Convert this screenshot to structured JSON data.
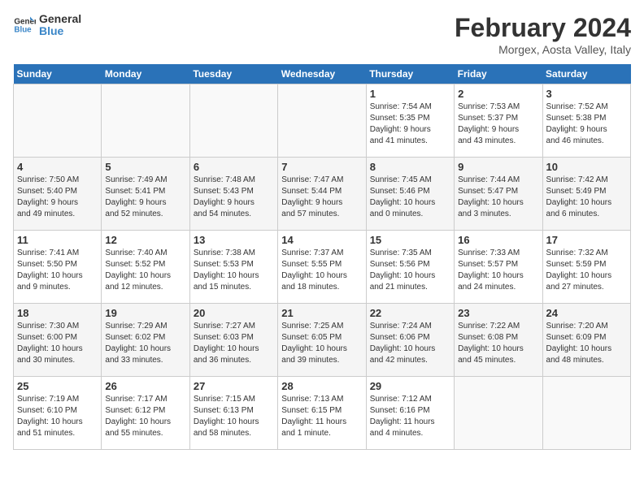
{
  "logo": {
    "line1": "General",
    "line2": "Blue"
  },
  "title": "February 2024",
  "location": "Morgex, Aosta Valley, Italy",
  "weekdays": [
    "Sunday",
    "Monday",
    "Tuesday",
    "Wednesday",
    "Thursday",
    "Friday",
    "Saturday"
  ],
  "weeks": [
    [
      {
        "day": "",
        "info": ""
      },
      {
        "day": "",
        "info": ""
      },
      {
        "day": "",
        "info": ""
      },
      {
        "day": "",
        "info": ""
      },
      {
        "day": "1",
        "info": "Sunrise: 7:54 AM\nSunset: 5:35 PM\nDaylight: 9 hours\nand 41 minutes."
      },
      {
        "day": "2",
        "info": "Sunrise: 7:53 AM\nSunset: 5:37 PM\nDaylight: 9 hours\nand 43 minutes."
      },
      {
        "day": "3",
        "info": "Sunrise: 7:52 AM\nSunset: 5:38 PM\nDaylight: 9 hours\nand 46 minutes."
      }
    ],
    [
      {
        "day": "4",
        "info": "Sunrise: 7:50 AM\nSunset: 5:40 PM\nDaylight: 9 hours\nand 49 minutes."
      },
      {
        "day": "5",
        "info": "Sunrise: 7:49 AM\nSunset: 5:41 PM\nDaylight: 9 hours\nand 52 minutes."
      },
      {
        "day": "6",
        "info": "Sunrise: 7:48 AM\nSunset: 5:43 PM\nDaylight: 9 hours\nand 54 minutes."
      },
      {
        "day": "7",
        "info": "Sunrise: 7:47 AM\nSunset: 5:44 PM\nDaylight: 9 hours\nand 57 minutes."
      },
      {
        "day": "8",
        "info": "Sunrise: 7:45 AM\nSunset: 5:46 PM\nDaylight: 10 hours\nand 0 minutes."
      },
      {
        "day": "9",
        "info": "Sunrise: 7:44 AM\nSunset: 5:47 PM\nDaylight: 10 hours\nand 3 minutes."
      },
      {
        "day": "10",
        "info": "Sunrise: 7:42 AM\nSunset: 5:49 PM\nDaylight: 10 hours\nand 6 minutes."
      }
    ],
    [
      {
        "day": "11",
        "info": "Sunrise: 7:41 AM\nSunset: 5:50 PM\nDaylight: 10 hours\nand 9 minutes."
      },
      {
        "day": "12",
        "info": "Sunrise: 7:40 AM\nSunset: 5:52 PM\nDaylight: 10 hours\nand 12 minutes."
      },
      {
        "day": "13",
        "info": "Sunrise: 7:38 AM\nSunset: 5:53 PM\nDaylight: 10 hours\nand 15 minutes."
      },
      {
        "day": "14",
        "info": "Sunrise: 7:37 AM\nSunset: 5:55 PM\nDaylight: 10 hours\nand 18 minutes."
      },
      {
        "day": "15",
        "info": "Sunrise: 7:35 AM\nSunset: 5:56 PM\nDaylight: 10 hours\nand 21 minutes."
      },
      {
        "day": "16",
        "info": "Sunrise: 7:33 AM\nSunset: 5:57 PM\nDaylight: 10 hours\nand 24 minutes."
      },
      {
        "day": "17",
        "info": "Sunrise: 7:32 AM\nSunset: 5:59 PM\nDaylight: 10 hours\nand 27 minutes."
      }
    ],
    [
      {
        "day": "18",
        "info": "Sunrise: 7:30 AM\nSunset: 6:00 PM\nDaylight: 10 hours\nand 30 minutes."
      },
      {
        "day": "19",
        "info": "Sunrise: 7:29 AM\nSunset: 6:02 PM\nDaylight: 10 hours\nand 33 minutes."
      },
      {
        "day": "20",
        "info": "Sunrise: 7:27 AM\nSunset: 6:03 PM\nDaylight: 10 hours\nand 36 minutes."
      },
      {
        "day": "21",
        "info": "Sunrise: 7:25 AM\nSunset: 6:05 PM\nDaylight: 10 hours\nand 39 minutes."
      },
      {
        "day": "22",
        "info": "Sunrise: 7:24 AM\nSunset: 6:06 PM\nDaylight: 10 hours\nand 42 minutes."
      },
      {
        "day": "23",
        "info": "Sunrise: 7:22 AM\nSunset: 6:08 PM\nDaylight: 10 hours\nand 45 minutes."
      },
      {
        "day": "24",
        "info": "Sunrise: 7:20 AM\nSunset: 6:09 PM\nDaylight: 10 hours\nand 48 minutes."
      }
    ],
    [
      {
        "day": "25",
        "info": "Sunrise: 7:19 AM\nSunset: 6:10 PM\nDaylight: 10 hours\nand 51 minutes."
      },
      {
        "day": "26",
        "info": "Sunrise: 7:17 AM\nSunset: 6:12 PM\nDaylight: 10 hours\nand 55 minutes."
      },
      {
        "day": "27",
        "info": "Sunrise: 7:15 AM\nSunset: 6:13 PM\nDaylight: 10 hours\nand 58 minutes."
      },
      {
        "day": "28",
        "info": "Sunrise: 7:13 AM\nSunset: 6:15 PM\nDaylight: 11 hours\nand 1 minute."
      },
      {
        "day": "29",
        "info": "Sunrise: 7:12 AM\nSunset: 6:16 PM\nDaylight: 11 hours\nand 4 minutes."
      },
      {
        "day": "",
        "info": ""
      },
      {
        "day": "",
        "info": ""
      }
    ]
  ]
}
